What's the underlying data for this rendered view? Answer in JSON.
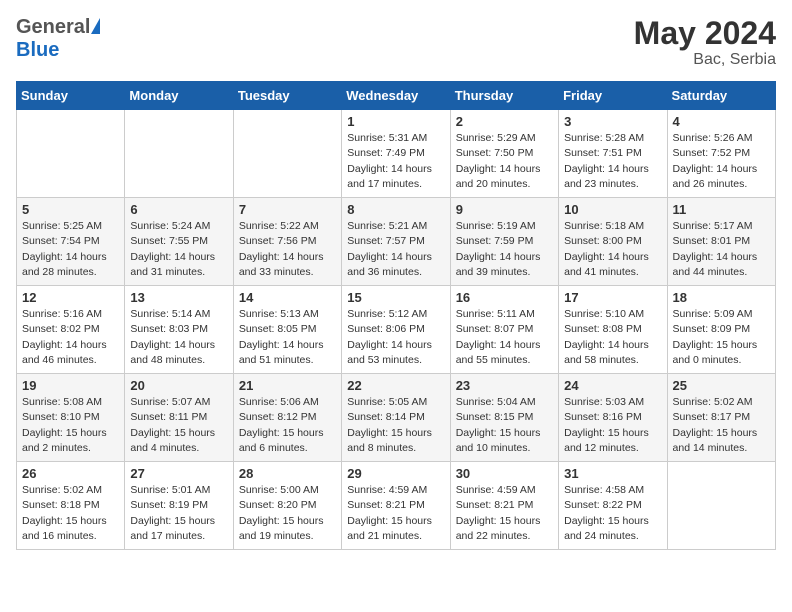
{
  "header": {
    "logo_general": "General",
    "logo_blue": "Blue",
    "month_year": "May 2024",
    "location": "Bac, Serbia"
  },
  "weekdays": [
    "Sunday",
    "Monday",
    "Tuesday",
    "Wednesday",
    "Thursday",
    "Friday",
    "Saturday"
  ],
  "weeks": [
    [
      {
        "day": "",
        "info": ""
      },
      {
        "day": "",
        "info": ""
      },
      {
        "day": "",
        "info": ""
      },
      {
        "day": "1",
        "info": "Sunrise: 5:31 AM\nSunset: 7:49 PM\nDaylight: 14 hours\nand 17 minutes."
      },
      {
        "day": "2",
        "info": "Sunrise: 5:29 AM\nSunset: 7:50 PM\nDaylight: 14 hours\nand 20 minutes."
      },
      {
        "day": "3",
        "info": "Sunrise: 5:28 AM\nSunset: 7:51 PM\nDaylight: 14 hours\nand 23 minutes."
      },
      {
        "day": "4",
        "info": "Sunrise: 5:26 AM\nSunset: 7:52 PM\nDaylight: 14 hours\nand 26 minutes."
      }
    ],
    [
      {
        "day": "5",
        "info": "Sunrise: 5:25 AM\nSunset: 7:54 PM\nDaylight: 14 hours\nand 28 minutes."
      },
      {
        "day": "6",
        "info": "Sunrise: 5:24 AM\nSunset: 7:55 PM\nDaylight: 14 hours\nand 31 minutes."
      },
      {
        "day": "7",
        "info": "Sunrise: 5:22 AM\nSunset: 7:56 PM\nDaylight: 14 hours\nand 33 minutes."
      },
      {
        "day": "8",
        "info": "Sunrise: 5:21 AM\nSunset: 7:57 PM\nDaylight: 14 hours\nand 36 minutes."
      },
      {
        "day": "9",
        "info": "Sunrise: 5:19 AM\nSunset: 7:59 PM\nDaylight: 14 hours\nand 39 minutes."
      },
      {
        "day": "10",
        "info": "Sunrise: 5:18 AM\nSunset: 8:00 PM\nDaylight: 14 hours\nand 41 minutes."
      },
      {
        "day": "11",
        "info": "Sunrise: 5:17 AM\nSunset: 8:01 PM\nDaylight: 14 hours\nand 44 minutes."
      }
    ],
    [
      {
        "day": "12",
        "info": "Sunrise: 5:16 AM\nSunset: 8:02 PM\nDaylight: 14 hours\nand 46 minutes."
      },
      {
        "day": "13",
        "info": "Sunrise: 5:14 AM\nSunset: 8:03 PM\nDaylight: 14 hours\nand 48 minutes."
      },
      {
        "day": "14",
        "info": "Sunrise: 5:13 AM\nSunset: 8:05 PM\nDaylight: 14 hours\nand 51 minutes."
      },
      {
        "day": "15",
        "info": "Sunrise: 5:12 AM\nSunset: 8:06 PM\nDaylight: 14 hours\nand 53 minutes."
      },
      {
        "day": "16",
        "info": "Sunrise: 5:11 AM\nSunset: 8:07 PM\nDaylight: 14 hours\nand 55 minutes."
      },
      {
        "day": "17",
        "info": "Sunrise: 5:10 AM\nSunset: 8:08 PM\nDaylight: 14 hours\nand 58 minutes."
      },
      {
        "day": "18",
        "info": "Sunrise: 5:09 AM\nSunset: 8:09 PM\nDaylight: 15 hours\nand 0 minutes."
      }
    ],
    [
      {
        "day": "19",
        "info": "Sunrise: 5:08 AM\nSunset: 8:10 PM\nDaylight: 15 hours\nand 2 minutes."
      },
      {
        "day": "20",
        "info": "Sunrise: 5:07 AM\nSunset: 8:11 PM\nDaylight: 15 hours\nand 4 minutes."
      },
      {
        "day": "21",
        "info": "Sunrise: 5:06 AM\nSunset: 8:12 PM\nDaylight: 15 hours\nand 6 minutes."
      },
      {
        "day": "22",
        "info": "Sunrise: 5:05 AM\nSunset: 8:14 PM\nDaylight: 15 hours\nand 8 minutes."
      },
      {
        "day": "23",
        "info": "Sunrise: 5:04 AM\nSunset: 8:15 PM\nDaylight: 15 hours\nand 10 minutes."
      },
      {
        "day": "24",
        "info": "Sunrise: 5:03 AM\nSunset: 8:16 PM\nDaylight: 15 hours\nand 12 minutes."
      },
      {
        "day": "25",
        "info": "Sunrise: 5:02 AM\nSunset: 8:17 PM\nDaylight: 15 hours\nand 14 minutes."
      }
    ],
    [
      {
        "day": "26",
        "info": "Sunrise: 5:02 AM\nSunset: 8:18 PM\nDaylight: 15 hours\nand 16 minutes."
      },
      {
        "day": "27",
        "info": "Sunrise: 5:01 AM\nSunset: 8:19 PM\nDaylight: 15 hours\nand 17 minutes."
      },
      {
        "day": "28",
        "info": "Sunrise: 5:00 AM\nSunset: 8:20 PM\nDaylight: 15 hours\nand 19 minutes."
      },
      {
        "day": "29",
        "info": "Sunrise: 4:59 AM\nSunset: 8:21 PM\nDaylight: 15 hours\nand 21 minutes."
      },
      {
        "day": "30",
        "info": "Sunrise: 4:59 AM\nSunset: 8:21 PM\nDaylight: 15 hours\nand 22 minutes."
      },
      {
        "day": "31",
        "info": "Sunrise: 4:58 AM\nSunset: 8:22 PM\nDaylight: 15 hours\nand 24 minutes."
      },
      {
        "day": "",
        "info": ""
      }
    ]
  ]
}
